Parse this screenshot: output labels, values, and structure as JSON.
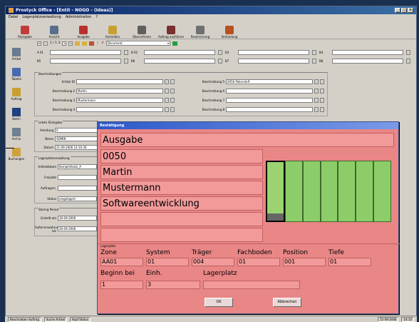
{
  "window": {
    "title": "Prostyck Office - [Entit - NOGO - (Ideas)]"
  },
  "menu": [
    "Datei",
    "Lagerplatzverwaltung",
    "Administration",
    "?"
  ],
  "toolbar": [
    {
      "label": "Rückgabe",
      "icon": "return-icon",
      "color": "#c23b3b"
    },
    {
      "label": "Ansicht",
      "icon": "view-icon",
      "color": "#5a6e8c"
    },
    {
      "label": "Ausgabe",
      "icon": "issue-icon",
      "color": "#b83030"
    },
    {
      "label": "Anmelden",
      "icon": "login-icon",
      "color": "#c8a030"
    },
    {
      "label": "Übernehmen",
      "icon": "accept-icon",
      "color": "#606060"
    },
    {
      "label": "Auftrag ausführen",
      "icon": "execute-icon",
      "color": "#7a3030"
    },
    {
      "label": "Reservierung",
      "icon": "reserve-icon",
      "color": "#707070"
    },
    {
      "label": "Verbindung",
      "icon": "connect-icon",
      "color": "#b85020"
    }
  ],
  "nav": {
    "counter": "1 / 1 3",
    "doc_label": "Document"
  },
  "sidebar": [
    {
      "label": "Artikel",
      "icon": "article-icon"
    },
    {
      "label": "Tabelle",
      "icon": "table-icon"
    },
    {
      "label": "Auftrag",
      "icon": "order-icon"
    },
    {
      "label": "Batch",
      "icon": "batch-icon"
    },
    {
      "label": "Archiv",
      "icon": "archive-icon"
    },
    {
      "label": "Buchungen",
      "icon": "bookings-icon"
    }
  ],
  "filters": {
    "row1": [
      "A 01",
      "B 02",
      "B3",
      "B4"
    ],
    "row2": [
      "B5",
      "B6",
      "B7",
      "B8"
    ]
  },
  "beschreibungen": {
    "title": "Beschreibungen",
    "left": [
      {
        "label": "Artikel ID",
        "value": ""
      },
      {
        "label": "Beschreibung 2",
        "value": "Martin"
      },
      {
        "label": "Beschreibung 3",
        "value": "Mustermann"
      },
      {
        "label": "Beschreibung 4",
        "value": ""
      }
    ],
    "right": [
      {
        "label": "Beschreibung 5",
        "value": "0050 Polierstelf"
      },
      {
        "label": "Beschreibung 6",
        "value": ""
      },
      {
        "label": "Beschreibung 7",
        "value": ""
      },
      {
        "label": "Beschreibung 8",
        "value": ""
      }
    ]
  },
  "letzte": {
    "title": "Letzte Rückgabe",
    "rows": [
      {
        "label": "Anleitung",
        "value": "0"
      },
      {
        "label": "Name",
        "value": "ADMIN"
      },
      {
        "label": "Datum",
        "value": "21-09-2006 14:10:36"
      }
    ]
  },
  "lagerplatz": {
    "title": "Lagerplatzverwaltung",
    "rows": [
      {
        "label": "Artikeldatum",
        "value": "Komplettsatz_A"
      },
      {
        "label": "Freiplatz",
        "value": ""
      },
      {
        "label": "Auftragsnr.",
        "value": ""
      },
      {
        "label": "Status",
        "value": "eingelagert"
      }
    ]
  },
  "storing": {
    "title": "Storing Period",
    "rows": [
      {
        "label": "Erstellt am",
        "value": "30-09-2006"
      },
      {
        "label": "Außerverwahrung bis",
        "value": "30-09-2006"
      }
    ]
  },
  "dialog": {
    "title": "Bestätigung",
    "fields": [
      "Ausgabe",
      "0050",
      "Martin",
      "Mustermann",
      "Softwareentwicklung"
    ],
    "lagerplatz_label": "Lagerplatz",
    "loc_headers": [
      "Zone",
      "System",
      "Träger",
      "Fachboden",
      "Position",
      "Tiefe"
    ],
    "loc_values": [
      "AA01",
      "01",
      "004",
      "01",
      "001",
      "01"
    ],
    "row2_headers": [
      "Beginn bei",
      "Einh.",
      "Lagerplatz"
    ],
    "row2_values": [
      "1",
      "3",
      ""
    ],
    "ok_label": "OK",
    "cancel_label": "Abbrechen",
    "rack_bins": 7,
    "selected_bin": 1,
    "selected_fill": 0.12
  },
  "statusbar": [
    "Beschrieben Auftrag",
    "Suche Artikel",
    "Kopf Status",
    "21-09-2006",
    "14:10"
  ]
}
